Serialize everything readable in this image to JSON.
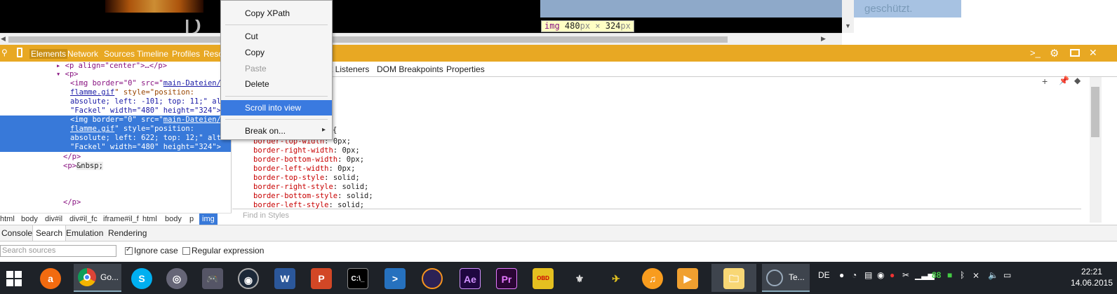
{
  "preview": {
    "side_text": "geschützt.",
    "tooltip_tag": "img",
    "tooltip_w": "480",
    "tooltip_x": "px × ",
    "tooltip_h": "324",
    "tooltip_unit": "px"
  },
  "devtools": {
    "tabs": [
      "Elements",
      "Network",
      "Sources",
      "Timeline",
      "Profiles",
      "Reso"
    ],
    "active_tab": "Elements"
  },
  "elements": {
    "line1_tag": "▸ <p align=\"center\">…</p>",
    "line2": "▾ <p>",
    "img1": {
      "l1": "<img border=\"0\" src=\"",
      "l1_link": "main-Dateien/",
      "l2_link": "flamme.gif",
      "l2": "\" style=\"position:",
      "l3": "absolute; left: -101; top: 11;\" alt=",
      "l4": "\"Fackel\" width=\"480\" height=\"324\">"
    },
    "img2": {
      "l1": "<img border=\"0\" src=\"",
      "l1_link": "main-Dateien/",
      "l2_link": "flamme.gif",
      "l2": "\" style=\"position:",
      "l3": "absolute; left: 622; top: 12;\" alt=",
      "l4": "\"Fackel\" width=\"480\" height=\"324\">"
    },
    "close_p": "</p>",
    "nbsp_open": "<p>",
    "nbsp": "&nbsp;",
    "close_p2": "</p>"
  },
  "breadcrumbs": [
    "html",
    "body",
    "div#il",
    "div#il_fc",
    "iframe#il_f",
    "html",
    "body",
    "p",
    "img"
  ],
  "styles": {
    "tabs": [
      "t Listeners",
      "DOM Breakpoints",
      "Properties"
    ],
    "brace": "{",
    "rules": [
      {
        "prop": "border-top-width",
        "val": "0px;"
      },
      {
        "prop": "border-right-width",
        "val": "0px;"
      },
      {
        "prop": "border-bottom-width",
        "val": "0px;"
      },
      {
        "prop": "border-left-width",
        "val": "0px;"
      },
      {
        "prop": "border-top-style",
        "val": "solid;"
      },
      {
        "prop": "border-right-style",
        "val": "solid;"
      },
      {
        "prop": "border-bottom-style",
        "val": "solid;"
      },
      {
        "prop": "border-left-style",
        "val": "solid;"
      }
    ],
    "find_placeholder": "Find in Styles"
  },
  "context_menu": {
    "copy_xpath": "Copy XPath",
    "cut": "Cut",
    "copy": "Copy",
    "paste": "Paste",
    "delete": "Delete",
    "scroll_into_view": "Scroll into view",
    "break_on": "Break on...",
    "submenu_arrow": "▸"
  },
  "drawer": {
    "tabs": [
      "Console",
      "Search",
      "Emulation",
      "Rendering"
    ],
    "active_tab": "Search",
    "search_placeholder": "Search sources",
    "ignore_case": "Ignore case",
    "regex": "Regular expression"
  },
  "taskbar": {
    "chrome_label": "Go...",
    "terminal_label": "Te...",
    "lang": "DE",
    "tray_num": "88",
    "time": "22:21",
    "date": "14.06.2015"
  },
  "colors": {
    "devtools_accent": "#e8a823",
    "selection": "#3879d9",
    "menu_hover": "#3a7ae0",
    "taskbar_bg": "#1e2228"
  }
}
